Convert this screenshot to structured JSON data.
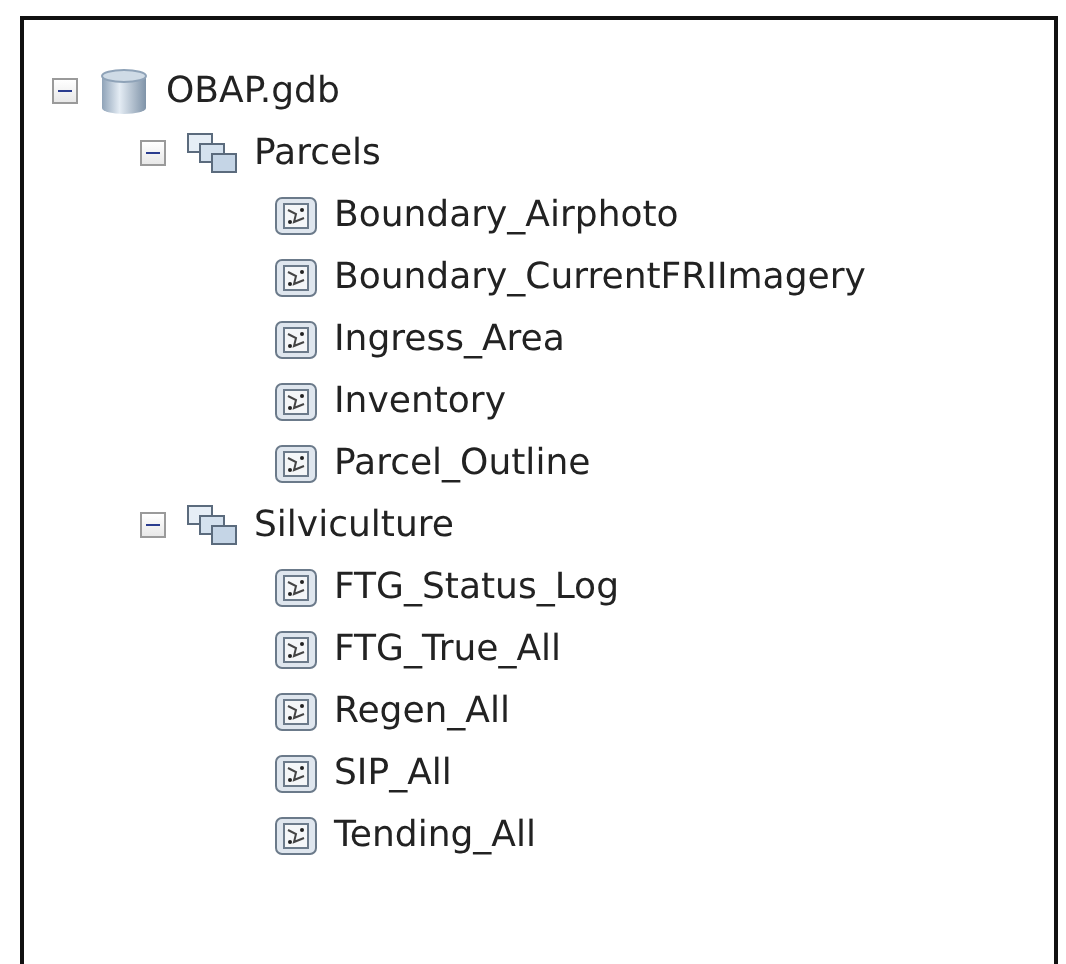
{
  "tree": [
    {
      "label": "OBAP.gdb",
      "kind": "database",
      "expanded": true,
      "children": [
        {
          "label": "Parcels",
          "kind": "dataset",
          "expanded": true,
          "children": [
            {
              "label": "Boundary_Airphoto",
              "kind": "feature-class"
            },
            {
              "label": "Boundary_CurrentFRIImagery",
              "kind": "feature-class"
            },
            {
              "label": "Ingress_Area",
              "kind": "feature-class"
            },
            {
              "label": "Inventory",
              "kind": "feature-class"
            },
            {
              "label": "Parcel_Outline",
              "kind": "feature-class"
            }
          ]
        },
        {
          "label": "Silviculture",
          "kind": "dataset",
          "expanded": true,
          "children": [
            {
              "label": "FTG_Status_Log",
              "kind": "feature-class"
            },
            {
              "label": "FTG_True_All",
              "kind": "feature-class"
            },
            {
              "label": "Regen_All",
              "kind": "feature-class"
            },
            {
              "label": "SIP_All",
              "kind": "feature-class"
            },
            {
              "label": "Tending_All",
              "kind": "feature-class"
            }
          ]
        }
      ]
    }
  ]
}
